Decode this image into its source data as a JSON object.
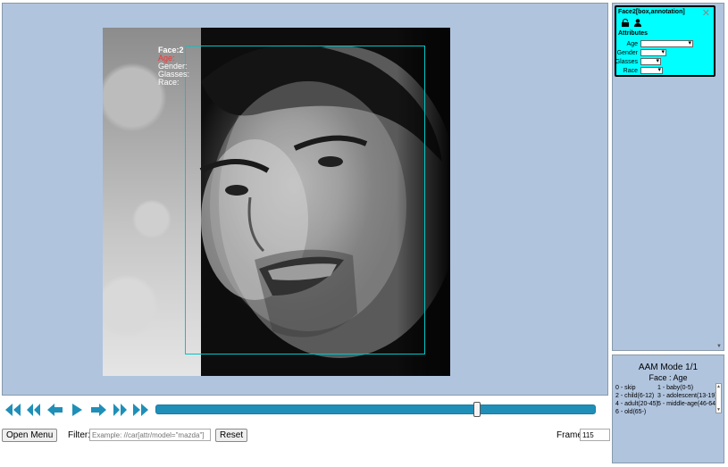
{
  "face_label": {
    "title": "Face:2",
    "age": "Age:",
    "gender": "Gender:",
    "glasses": "Glasses:",
    "race": "Race:"
  },
  "player": {
    "buttons": [
      "first-frame",
      "fast-backward",
      "step-backward",
      "play",
      "step-forward",
      "fast-forward",
      "last-frame"
    ],
    "progress": 0.735,
    "accent_color": "#1f8fb8"
  },
  "bottom_bar": {
    "open_menu_label": "Open Menu",
    "filter_label": "Filter:",
    "filter_placeholder": "Example: //car[attr/model=\"mazda\"]",
    "reset_label": "Reset",
    "frame_label": "Frame",
    "frame_value": "115"
  },
  "annotation_card": {
    "title": "Face2[box,annotation]",
    "close_symbol": "✕",
    "attributes_heading": "Attributes",
    "attributes": [
      {
        "label": "Age",
        "value": ""
      },
      {
        "label": "Gender",
        "value": ""
      },
      {
        "label": "Glasses",
        "value": ""
      },
      {
        "label": "Race",
        "value": ""
      }
    ],
    "card_color": "#00ffff"
  },
  "aam": {
    "title": "AAM Mode 1/1",
    "subtitle": "Face : Age",
    "items": [
      "0 - skip",
      "1 - baby(0-5)",
      "2 - child(6-12)",
      "3 - adolescent(13-19)",
      "4 - adult(20-45)",
      "5 - middle-age(46-64)",
      "6 - old(65-)"
    ]
  },
  "colors": {
    "canvas_bg": "#b0c4de",
    "box_outline": "#00c6c6",
    "age_label": "#ff3030"
  }
}
